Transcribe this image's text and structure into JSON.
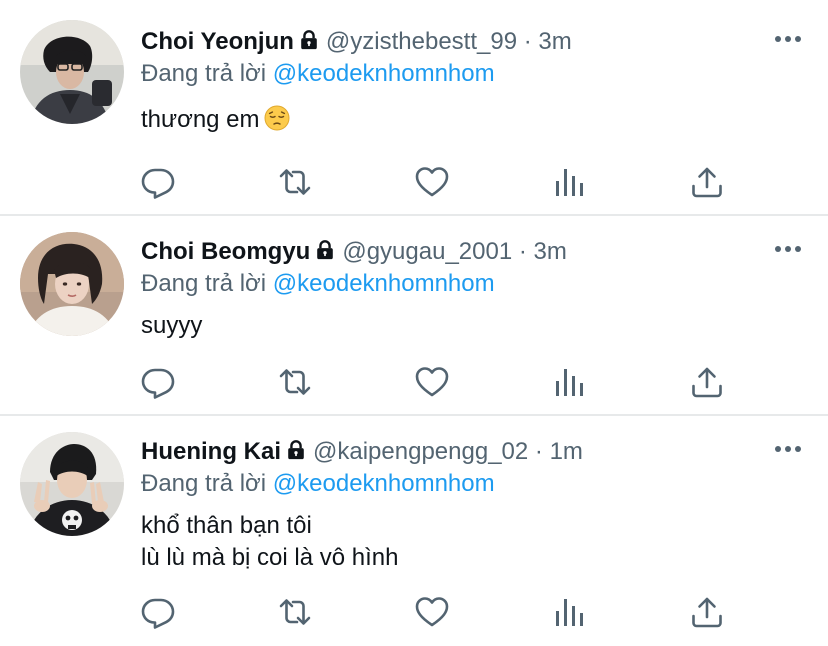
{
  "tweets": [
    {
      "display_name": "Choi Yeonjun",
      "handle": "@yzisthebestt_99",
      "separator": "·",
      "time": "3m",
      "reply_prefix": "Đang trả lời",
      "reply_to": "@keodeknhomnhom",
      "lines": [
        "thương em"
      ],
      "emoji": "pensive-face"
    },
    {
      "display_name": "Choi Beomgyu",
      "handle": "@gyugau_2001",
      "separator": "·",
      "time": "3m",
      "reply_prefix": "Đang trả lời",
      "reply_to": "@keodeknhomnhom",
      "lines": [
        "suyyy"
      ]
    },
    {
      "display_name": "Huening Kai",
      "handle": "@kaipengpengg_02",
      "separator": "·",
      "time": "1m",
      "reply_prefix": "Đang trả lời",
      "reply_to": "@keodeknhomnhom",
      "lines": [
        "khổ thân bạn tôi",
        "lù lù mà bị coi là vô hình"
      ]
    }
  ],
  "icons": {
    "lock": "lock-icon",
    "more": "more-icon",
    "reply": "reply-icon",
    "retweet": "retweet-icon",
    "like": "like-icon",
    "analytics": "analytics-icon",
    "share": "share-icon"
  },
  "colors": {
    "text": "#0f1419",
    "secondary": "#536471",
    "link": "#1d9bf0",
    "divider": "#e7e9ea"
  }
}
